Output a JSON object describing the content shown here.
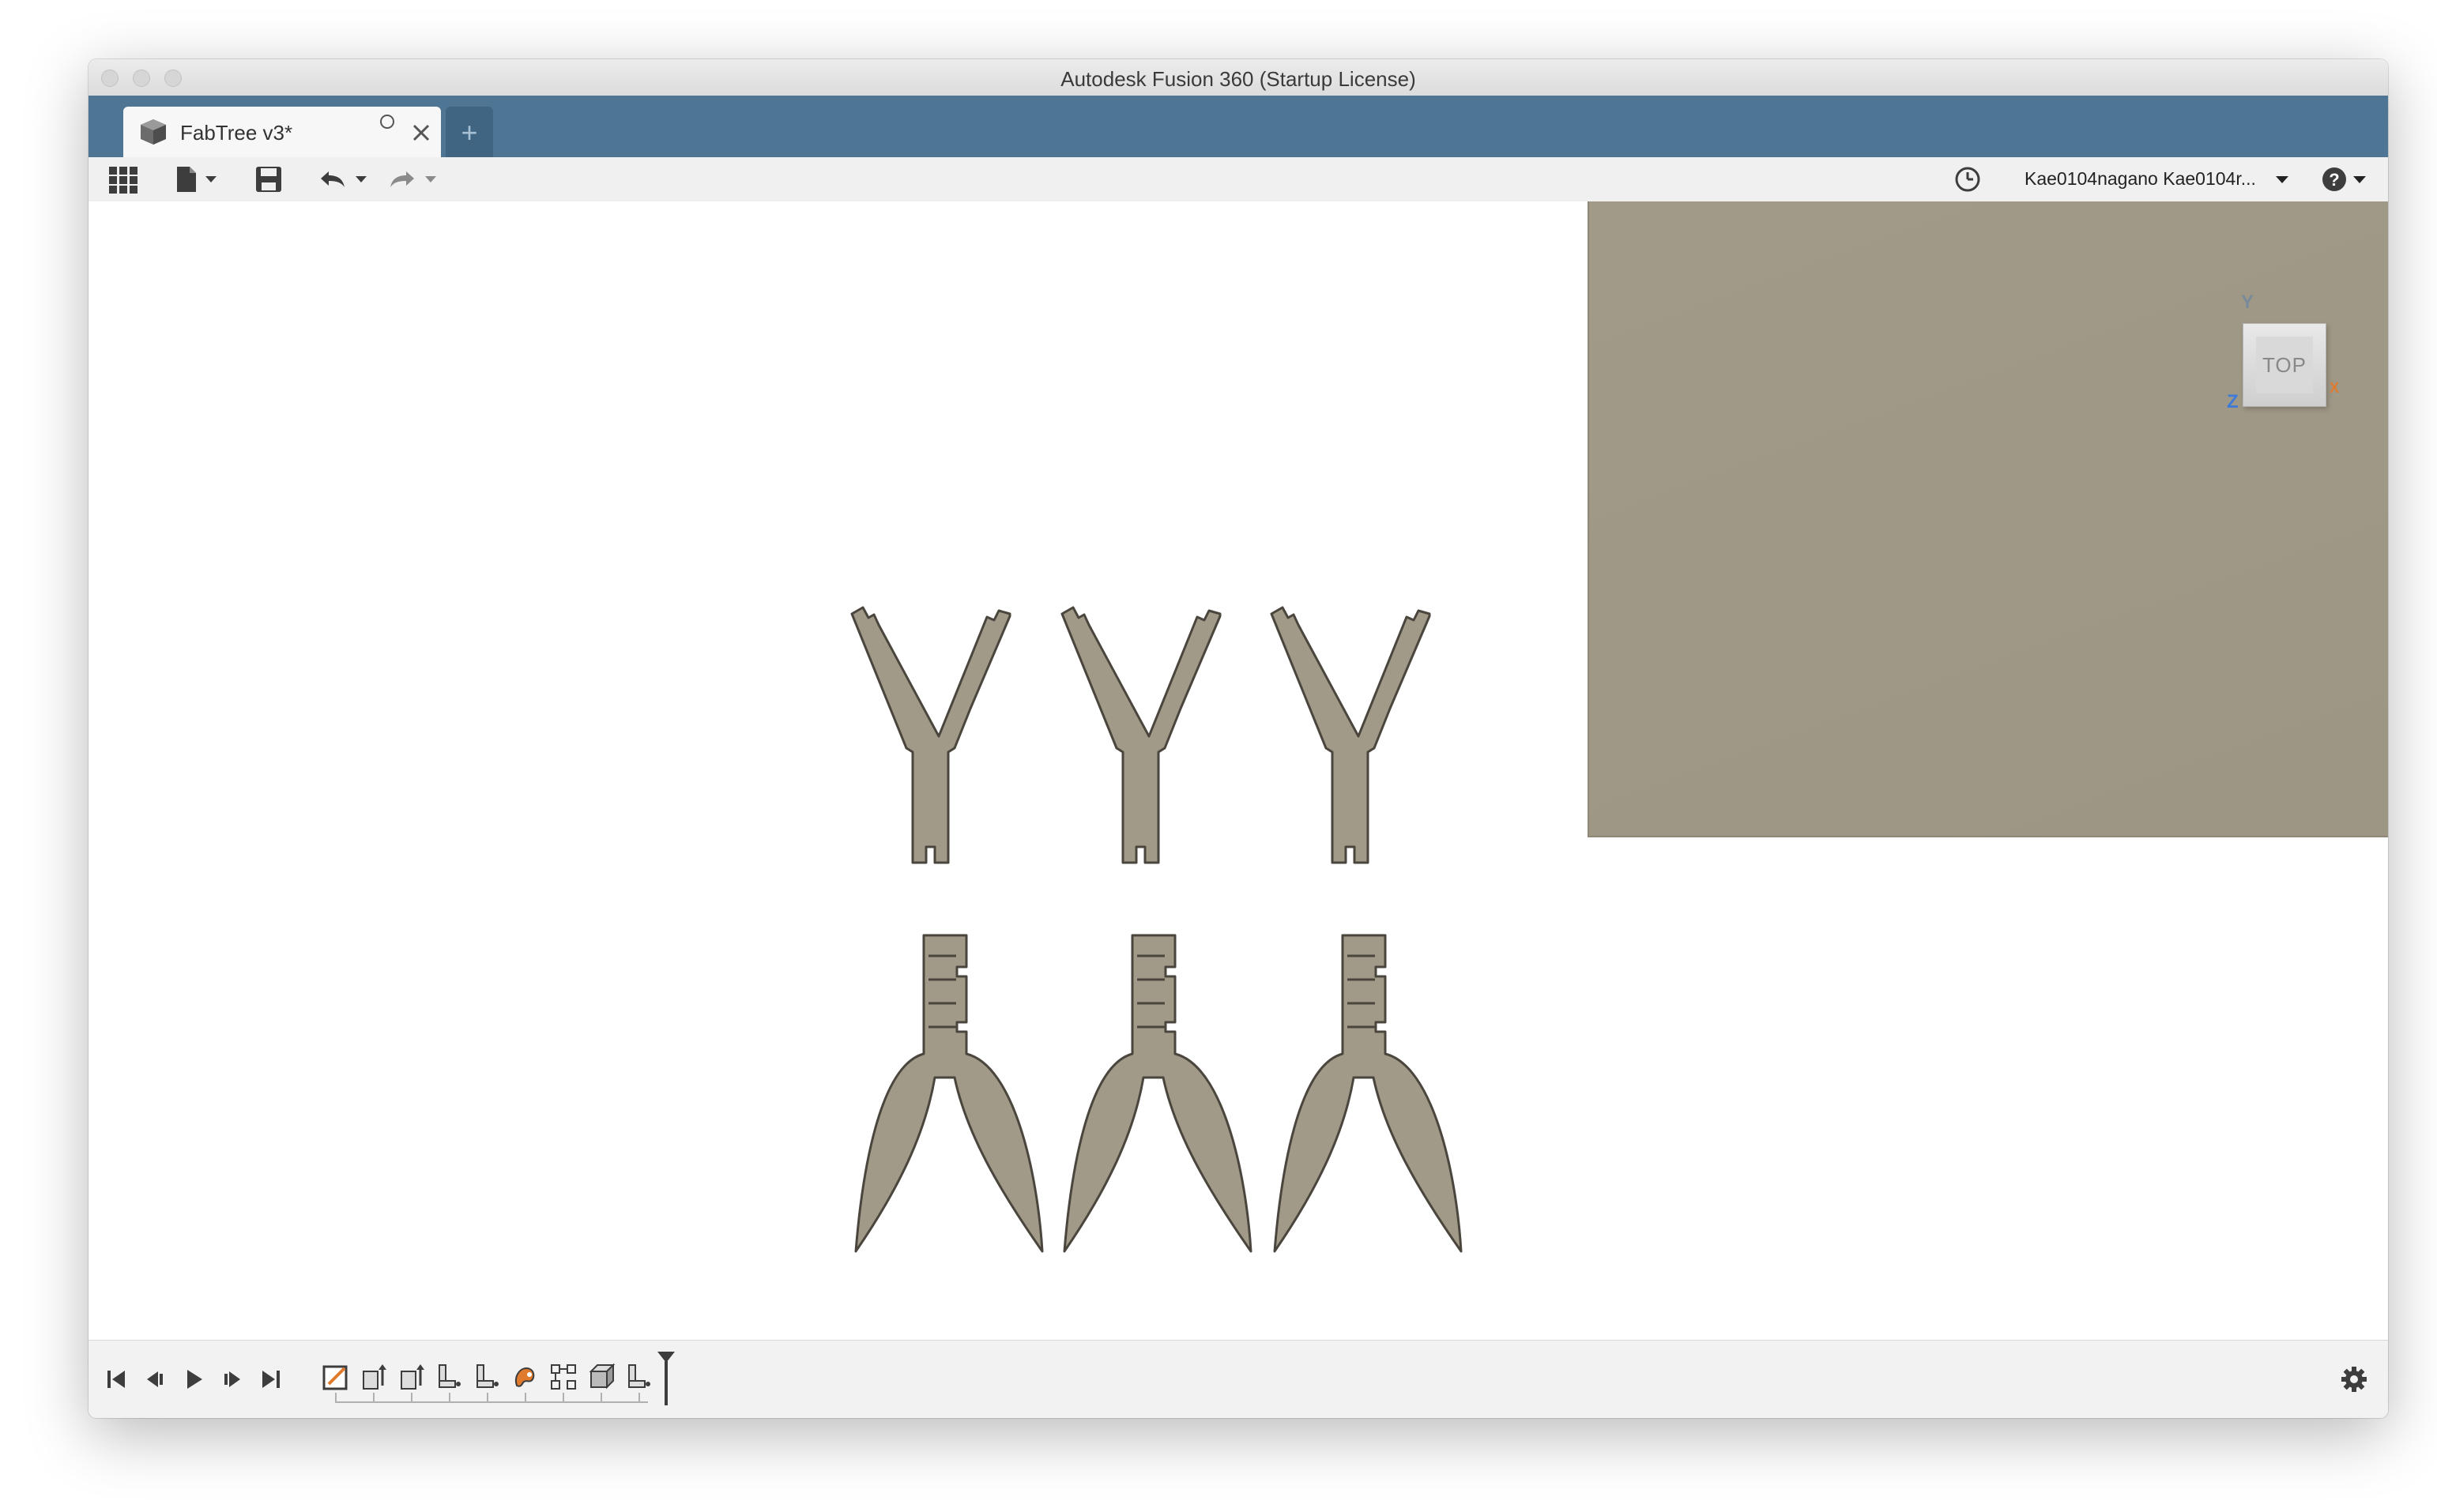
{
  "window": {
    "title": "Autodesk Fusion 360 (Startup License)"
  },
  "tabs": {
    "active_label": "FabTree v3*",
    "new_tab_symbol": "+"
  },
  "toolbar": {
    "user_label": "Kae0104nagano Kae0104r...",
    "icons": [
      "data-panel-grid-icon",
      "file-menu-icon",
      "save-icon",
      "undo-icon",
      "redo-icon",
      "job-status-clock-icon",
      "help-icon"
    ]
  },
  "viewcube": {
    "face_label": "TOP",
    "axis_y": "Y",
    "axis_z": "Z",
    "axis_x": "X"
  },
  "timeline": {
    "feature_icons": [
      "sketch-icon",
      "extrude-icon",
      "extrude-icon",
      "joint-icon",
      "joint-icon",
      "appearance-icon",
      "align-icon",
      "box-icon",
      "joint-icon"
    ]
  },
  "colors": {
    "tab_bar": "#4e7593",
    "part_fill": "#a29a88",
    "axis_y": "#7a8a9a",
    "axis_z": "#3f7bd6",
    "axis_x": "#e07a2c"
  }
}
